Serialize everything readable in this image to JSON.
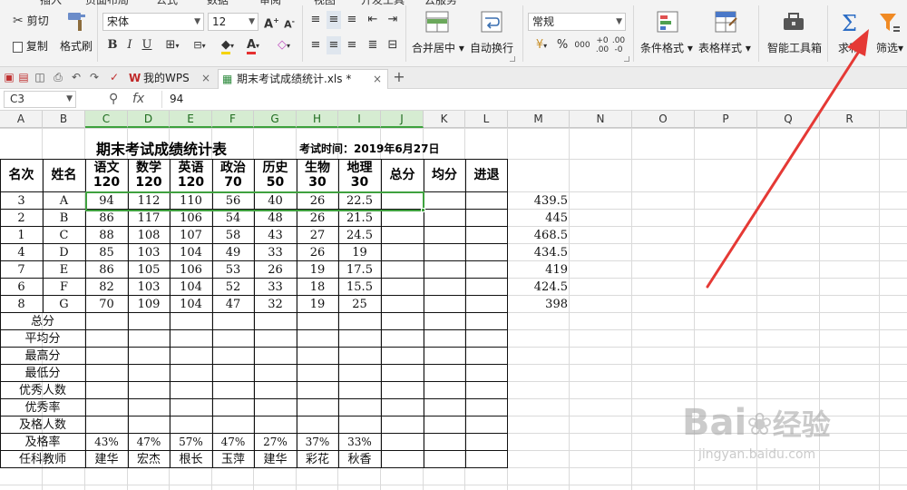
{
  "ribbon": {
    "menu_tabs": [
      "插入",
      "页面布局",
      "公式",
      "数据",
      "审阅",
      "视图",
      "开发工具",
      "云服务"
    ],
    "cut_label": "剪切",
    "copy_label": "复制",
    "format_painter_label": "格式刷",
    "font_name": "宋体",
    "font_size": "12",
    "number_format": "常规",
    "merge_center_label": "合并居中",
    "wrap_text_label": "自动换行",
    "conditional_format_label": "条件格式",
    "table_style_label": "表格样式",
    "smart_toolbox_label": "智能工具箱",
    "sum_label": "求和",
    "filter_label": "筛选",
    "percent_symbol": "%",
    "thousands_symbol": "000"
  },
  "tabs": [
    {
      "label": "我的WPS"
    },
    {
      "label": "期末考试成绩统计.xls *"
    }
  ],
  "formula_bar": {
    "cell_ref": "C3",
    "value": "94"
  },
  "columns": [
    "A",
    "B",
    "C",
    "D",
    "E",
    "F",
    "G",
    "H",
    "I",
    "J",
    "K",
    "L",
    "M",
    "N",
    "O",
    "P",
    "Q",
    "R"
  ],
  "sheet": {
    "title": "期末考试成绩统计表",
    "exam_time": "考试时间：2019年6月27日",
    "headers": [
      "名次",
      "姓名",
      "语文\n120",
      "数学\n120",
      "英语\n120",
      "政治\n70",
      "历史\n50",
      "生物\n30",
      "地理\n30",
      "总分",
      "均分",
      "进退"
    ],
    "rows": [
      [
        "3",
        "A",
        "94",
        "112",
        "110",
        "56",
        "40",
        "26",
        "22.5"
      ],
      [
        "2",
        "B",
        "86",
        "117",
        "106",
        "54",
        "48",
        "26",
        "21.5"
      ],
      [
        "1",
        "C",
        "88",
        "108",
        "107",
        "58",
        "43",
        "27",
        "24.5"
      ],
      [
        "4",
        "D",
        "85",
        "103",
        "104",
        "49",
        "33",
        "26",
        "19"
      ],
      [
        "7",
        "E",
        "86",
        "105",
        "106",
        "53",
        "26",
        "19",
        "17.5"
      ],
      [
        "6",
        "F",
        "82",
        "103",
        "104",
        "52",
        "33",
        "18",
        "15.5"
      ],
      [
        "8",
        "G",
        "70",
        "109",
        "104",
        "47",
        "32",
        "19",
        "25"
      ]
    ],
    "totals_col_m": [
      "439.5",
      "445",
      "468.5",
      "434.5",
      "419",
      "424.5",
      "398"
    ],
    "summary_labels": [
      "总分",
      "平均分",
      "最高分",
      "最低分",
      "优秀人数",
      "优秀率",
      "及格人数"
    ],
    "pass_rate_label": "及格率",
    "pass_rates": [
      "43%",
      "47%",
      "57%",
      "47%",
      "27%",
      "37%",
      "33%"
    ],
    "teacher_label": "任科教师",
    "teachers": [
      "建华",
      "宏杰",
      "根长",
      "玉萍",
      "建华",
      "彩花",
      "秋香"
    ]
  },
  "watermark": {
    "brand": "Bai",
    "brand_tail": "经验",
    "url": "jingyan.baidu.com"
  },
  "colors": {
    "selection": "#3fa13f",
    "arrow": "#e53935",
    "sum_icon": "#2b6cc4",
    "filter_icon": "#f08a24"
  }
}
